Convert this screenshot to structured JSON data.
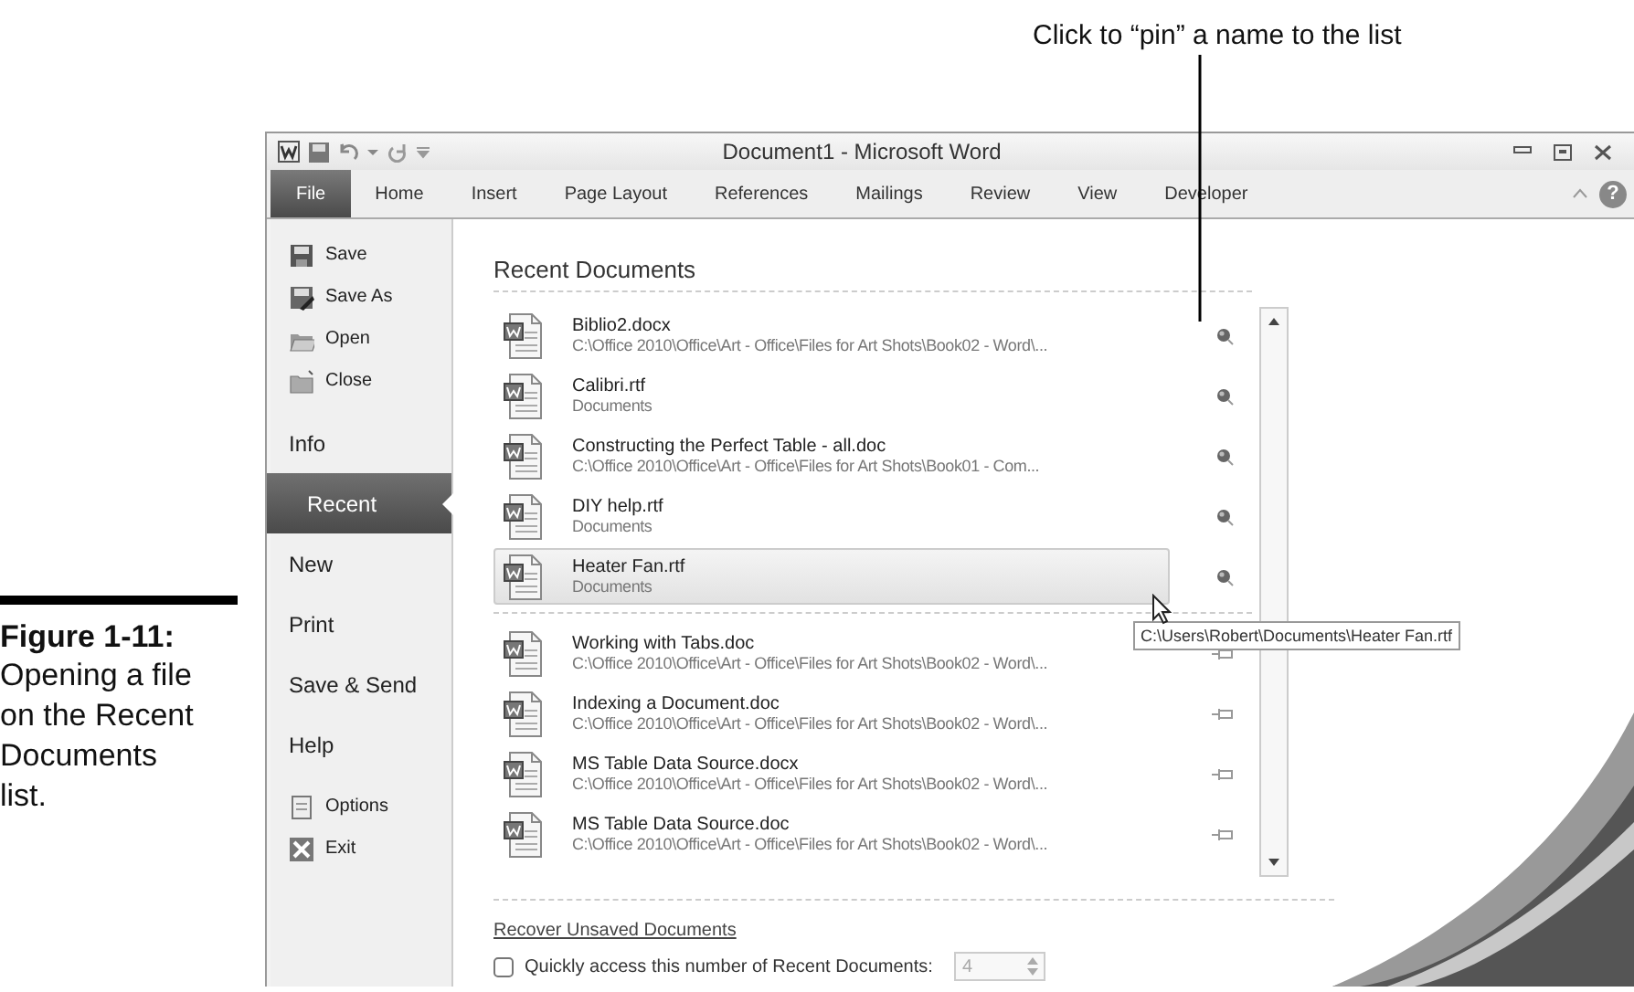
{
  "callout": "Click to “pin” a name to the list",
  "caption": {
    "label": "Figure 1-11:",
    "text": "Opening a file on the Recent Documents list."
  },
  "window": {
    "title": "Document1 - Microsoft Word"
  },
  "tabs": [
    {
      "label": "File",
      "selected": true
    },
    {
      "label": "Home",
      "selected": false
    },
    {
      "label": "Insert",
      "selected": false
    },
    {
      "label": "Page Layout",
      "selected": false
    },
    {
      "label": "References",
      "selected": false
    },
    {
      "label": "Mailings",
      "selected": false
    },
    {
      "label": "Review",
      "selected": false
    },
    {
      "label": "View",
      "selected": false
    },
    {
      "label": "Developer",
      "selected": false
    }
  ],
  "help_glyph": "?",
  "nav": [
    {
      "label": "Save",
      "kind": "command",
      "selected": false
    },
    {
      "label": "Save As",
      "kind": "command",
      "selected": false
    },
    {
      "label": "Open",
      "kind": "command",
      "selected": false
    },
    {
      "label": "Close",
      "kind": "command",
      "selected": false
    },
    {
      "label": "Info",
      "kind": "page",
      "selected": false
    },
    {
      "label": "Recent",
      "kind": "page",
      "selected": true
    },
    {
      "label": "New",
      "kind": "page",
      "selected": false
    },
    {
      "label": "Print",
      "kind": "page",
      "selected": false
    },
    {
      "label": "Save & Send",
      "kind": "page",
      "selected": false
    },
    {
      "label": "Help",
      "kind": "page",
      "selected": false
    },
    {
      "label": "Options",
      "kind": "command",
      "selected": false
    },
    {
      "label": "Exit",
      "kind": "command",
      "selected": false
    }
  ],
  "recent": {
    "heading": "Recent Documents",
    "documents": [
      {
        "name": "Biblio2.docx",
        "location": "C:\\Office 2010\\Office\\Art - Office\\Files for Art Shots\\Book02 - Word\\...",
        "pinned": true,
        "selected": false
      },
      {
        "name": "Calibri.rtf",
        "location": "Documents",
        "pinned": true,
        "selected": false
      },
      {
        "name": "Constructing the Perfect Table - all.doc",
        "location": "C:\\Office 2010\\Office\\Art - Office\\Files for Art Shots\\Book01 - Com...",
        "pinned": true,
        "selected": false
      },
      {
        "name": "DIY help.rtf",
        "location": "Documents",
        "pinned": true,
        "selected": false
      },
      {
        "name": "Heater Fan.rtf",
        "location": "Documents",
        "pinned": true,
        "selected": true
      },
      {
        "name": "Working with Tabs.doc",
        "location": "C:\\Office 2010\\Office\\Art - Office\\Files for Art Shots\\Book02 - Word\\...",
        "pinned": false,
        "selected": false
      },
      {
        "name": "Indexing a Document.doc",
        "location": "C:\\Office 2010\\Office\\Art - Office\\Files for Art Shots\\Book02 - Word\\...",
        "pinned": false,
        "selected": false
      },
      {
        "name": "MS Table Data Source.docx",
        "location": "C:\\Office 2010\\Office\\Art - Office\\Files for Art Shots\\Book02 - Word\\...",
        "pinned": false,
        "selected": false
      },
      {
        "name": "MS Table Data Source.doc",
        "location": "C:\\Office 2010\\Office\\Art - Office\\Files for Art Shots\\Book02 - Word\\...",
        "pinned": false,
        "selected": false
      }
    ],
    "tooltip": "C:\\Users\\Robert\\Documents\\Heater Fan.rtf",
    "recover_link": "Recover Unsaved Documents",
    "quick_access": {
      "label": "Quickly access this number of Recent Documents:",
      "checked": false,
      "value": "4",
      "disabled": true
    }
  }
}
